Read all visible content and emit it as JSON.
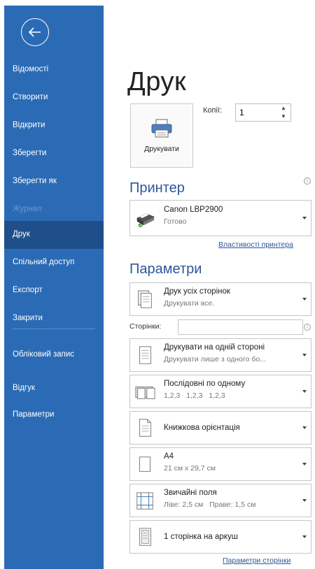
{
  "sidebar": {
    "items": [
      {
        "label": "Відомості"
      },
      {
        "label": "Створити"
      },
      {
        "label": "Відкрити"
      },
      {
        "label": "Зберегти"
      },
      {
        "label": "Зберегти як"
      },
      {
        "label": "Журнал"
      },
      {
        "label": "Друк"
      },
      {
        "label": "Спільний доступ"
      },
      {
        "label": "Експорт"
      },
      {
        "label": "Закрити"
      },
      {
        "label": "Обліковий запис"
      },
      {
        "label": "Відгук"
      },
      {
        "label": "Параметри"
      }
    ]
  },
  "main": {
    "title": "Друк",
    "print_button": {
      "label": "Друкувати"
    },
    "copies": {
      "label": "Копії:",
      "value": "1"
    },
    "printer": {
      "section_title": "Принтер",
      "name": "Canon LBP2900",
      "status": "Готово",
      "properties_link": "Властивості принтера"
    },
    "settings": {
      "section_title": "Параметри",
      "pages_label": "Сторінки:",
      "pages_value": "",
      "options": [
        {
          "title": "Друк усіх сторінок",
          "subtitle": "Друкувати все."
        },
        {
          "title": "Друкувати на одній стороні",
          "subtitle": "Друкувати лише з одного бо..."
        },
        {
          "title": "Послідовні по одному",
          "subtitle": "1,2,3   1,2,3   1,2,3"
        },
        {
          "title": "Книжкова орієнтація",
          "subtitle": ""
        },
        {
          "title": "A4",
          "subtitle": "21 см x 29,7 см"
        },
        {
          "title": "Звичайні поля",
          "subtitle": "Ліве: 2,5 см   Праве: 1,5 см"
        },
        {
          "title": "1 сторінка на аркуш",
          "subtitle": ""
        }
      ],
      "page_setup_link": "Параметри сторінки"
    }
  },
  "colors": {
    "sidebar_bg": "#2b6bb5",
    "sidebar_active": "#1f4f8a",
    "accent": "#2b579a"
  }
}
